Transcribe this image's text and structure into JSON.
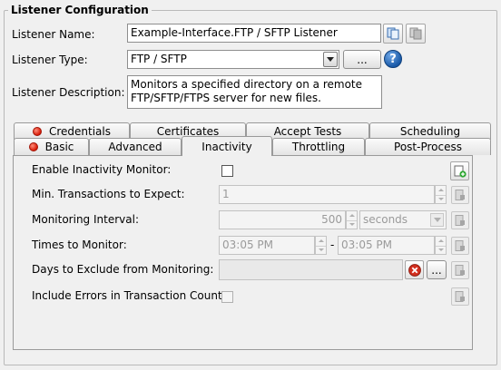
{
  "group_title": "Listener Configuration",
  "fields": {
    "name_label": "Listener Name:",
    "name_value": "Example-Interface.FTP / SFTP Listener",
    "type_label": "Listener Type:",
    "type_value": "FTP / SFTP",
    "type_browse_label": "...",
    "help_glyph": "?",
    "desc_label": "Listener Description:",
    "desc_value": "Monitors a specified directory on a remote FTP/SFTP/FTPS server for new files."
  },
  "tabs_row1": [
    {
      "label": "Credentials",
      "has_error": true
    },
    {
      "label": "Certificates",
      "has_error": false
    },
    {
      "label": "Accept Tests",
      "has_error": false
    },
    {
      "label": "Scheduling",
      "has_error": false
    }
  ],
  "tabs_row2": [
    {
      "label": "Basic",
      "has_error": true
    },
    {
      "label": "Advanced",
      "has_error": false
    },
    {
      "label": "Inactivity",
      "has_error": false,
      "active": true
    },
    {
      "label": "Throttling",
      "has_error": false
    },
    {
      "label": "Post-Process",
      "has_error": false
    }
  ],
  "inactivity": {
    "enable_label": "Enable Inactivity Monitor:",
    "enable_checked": false,
    "min_tx_label": "Min. Transactions to Expect:",
    "min_tx_value": "1",
    "interval_label": "Monitoring Interval:",
    "interval_value": "500",
    "interval_unit": "seconds",
    "times_label": "Times to Monitor:",
    "time_start": "03:05 PM",
    "time_separator": "-",
    "time_end": "03:05 PM",
    "days_label": "Days to Exclude from Monitoring:",
    "days_value": "",
    "days_browse_label": "...",
    "errors_label": "Include Errors in Transaction Count:",
    "errors_checked": false
  },
  "colors": {
    "error_dot": "#d81b07",
    "help_icon": "#1a5aa8",
    "clear_icon": "#d32f1f"
  }
}
